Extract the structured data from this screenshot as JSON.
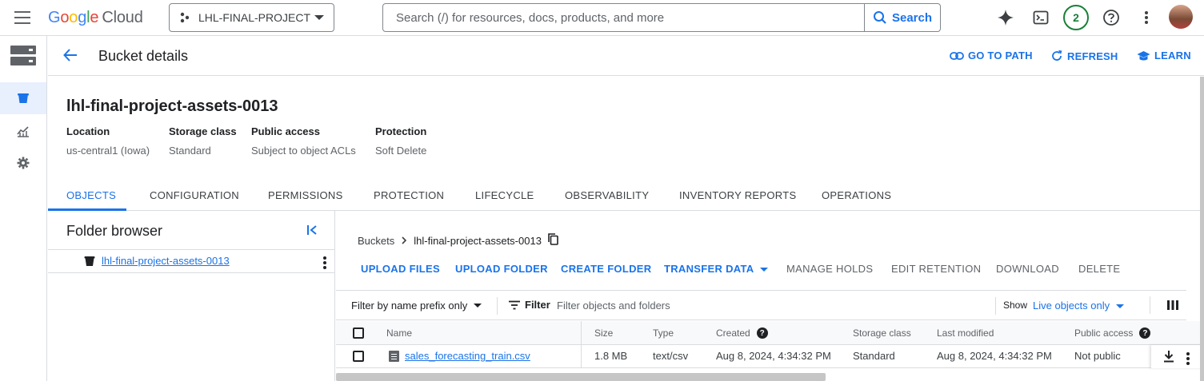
{
  "topbar": {
    "logo_google": "Google",
    "logo_cloud": "Cloud",
    "project_name": "LHL-FINAL-PROJECT",
    "search_placeholder": "Search (/) for resources, docs, products, and more",
    "search_button": "Search",
    "notification_count": "2"
  },
  "header": {
    "title": "Bucket details",
    "actions": [
      "GO TO PATH",
      "REFRESH",
      "LEARN"
    ]
  },
  "bucket": {
    "name": "lhl-final-project-assets-0013",
    "meta": [
      {
        "label": "Location",
        "value": "us-central1 (Iowa)"
      },
      {
        "label": "Storage class",
        "value": "Standard"
      },
      {
        "label": "Public access",
        "value": "Subject to object ACLs"
      },
      {
        "label": "Protection",
        "value": "Soft Delete"
      }
    ]
  },
  "tabs": [
    "OBJECTS",
    "CONFIGURATION",
    "PERMISSIONS",
    "PROTECTION",
    "LIFECYCLE",
    "OBSERVABILITY",
    "INVENTORY REPORTS",
    "OPERATIONS"
  ],
  "folder_browser": {
    "title": "Folder browser",
    "root": "lhl-final-project-assets-0013"
  },
  "breadcrumb": {
    "root": "Buckets",
    "current": "lhl-final-project-assets-0013"
  },
  "actions": {
    "primary": [
      "UPLOAD FILES",
      "UPLOAD FOLDER",
      "CREATE FOLDER",
      "TRANSFER DATA"
    ],
    "disabled": [
      "MANAGE HOLDS",
      "EDIT RETENTION",
      "DOWNLOAD",
      "DELETE"
    ]
  },
  "filter": {
    "prefix_mode": "Filter by name prefix only",
    "label": "Filter",
    "placeholder": "Filter objects and folders",
    "show_label": "Show",
    "show_value": "Live objects only"
  },
  "table": {
    "columns": [
      "Name",
      "Size",
      "Type",
      "Created",
      "Storage class",
      "Last modified",
      "Public access"
    ],
    "rows": [
      {
        "name": "sales_forecasting_train.csv",
        "size": "1.8 MB",
        "type": "text/csv",
        "created": "Aug 8, 2024, 4:34:32 PM",
        "storage_class": "Standard",
        "last_modified": "Aug 8, 2024, 4:34:32 PM",
        "public_access": "Not public"
      }
    ]
  },
  "colors": {
    "accent": "#1a73e8",
    "border": "#dadce0",
    "muted_text": "#5f6368",
    "badge_green": "#188038"
  }
}
